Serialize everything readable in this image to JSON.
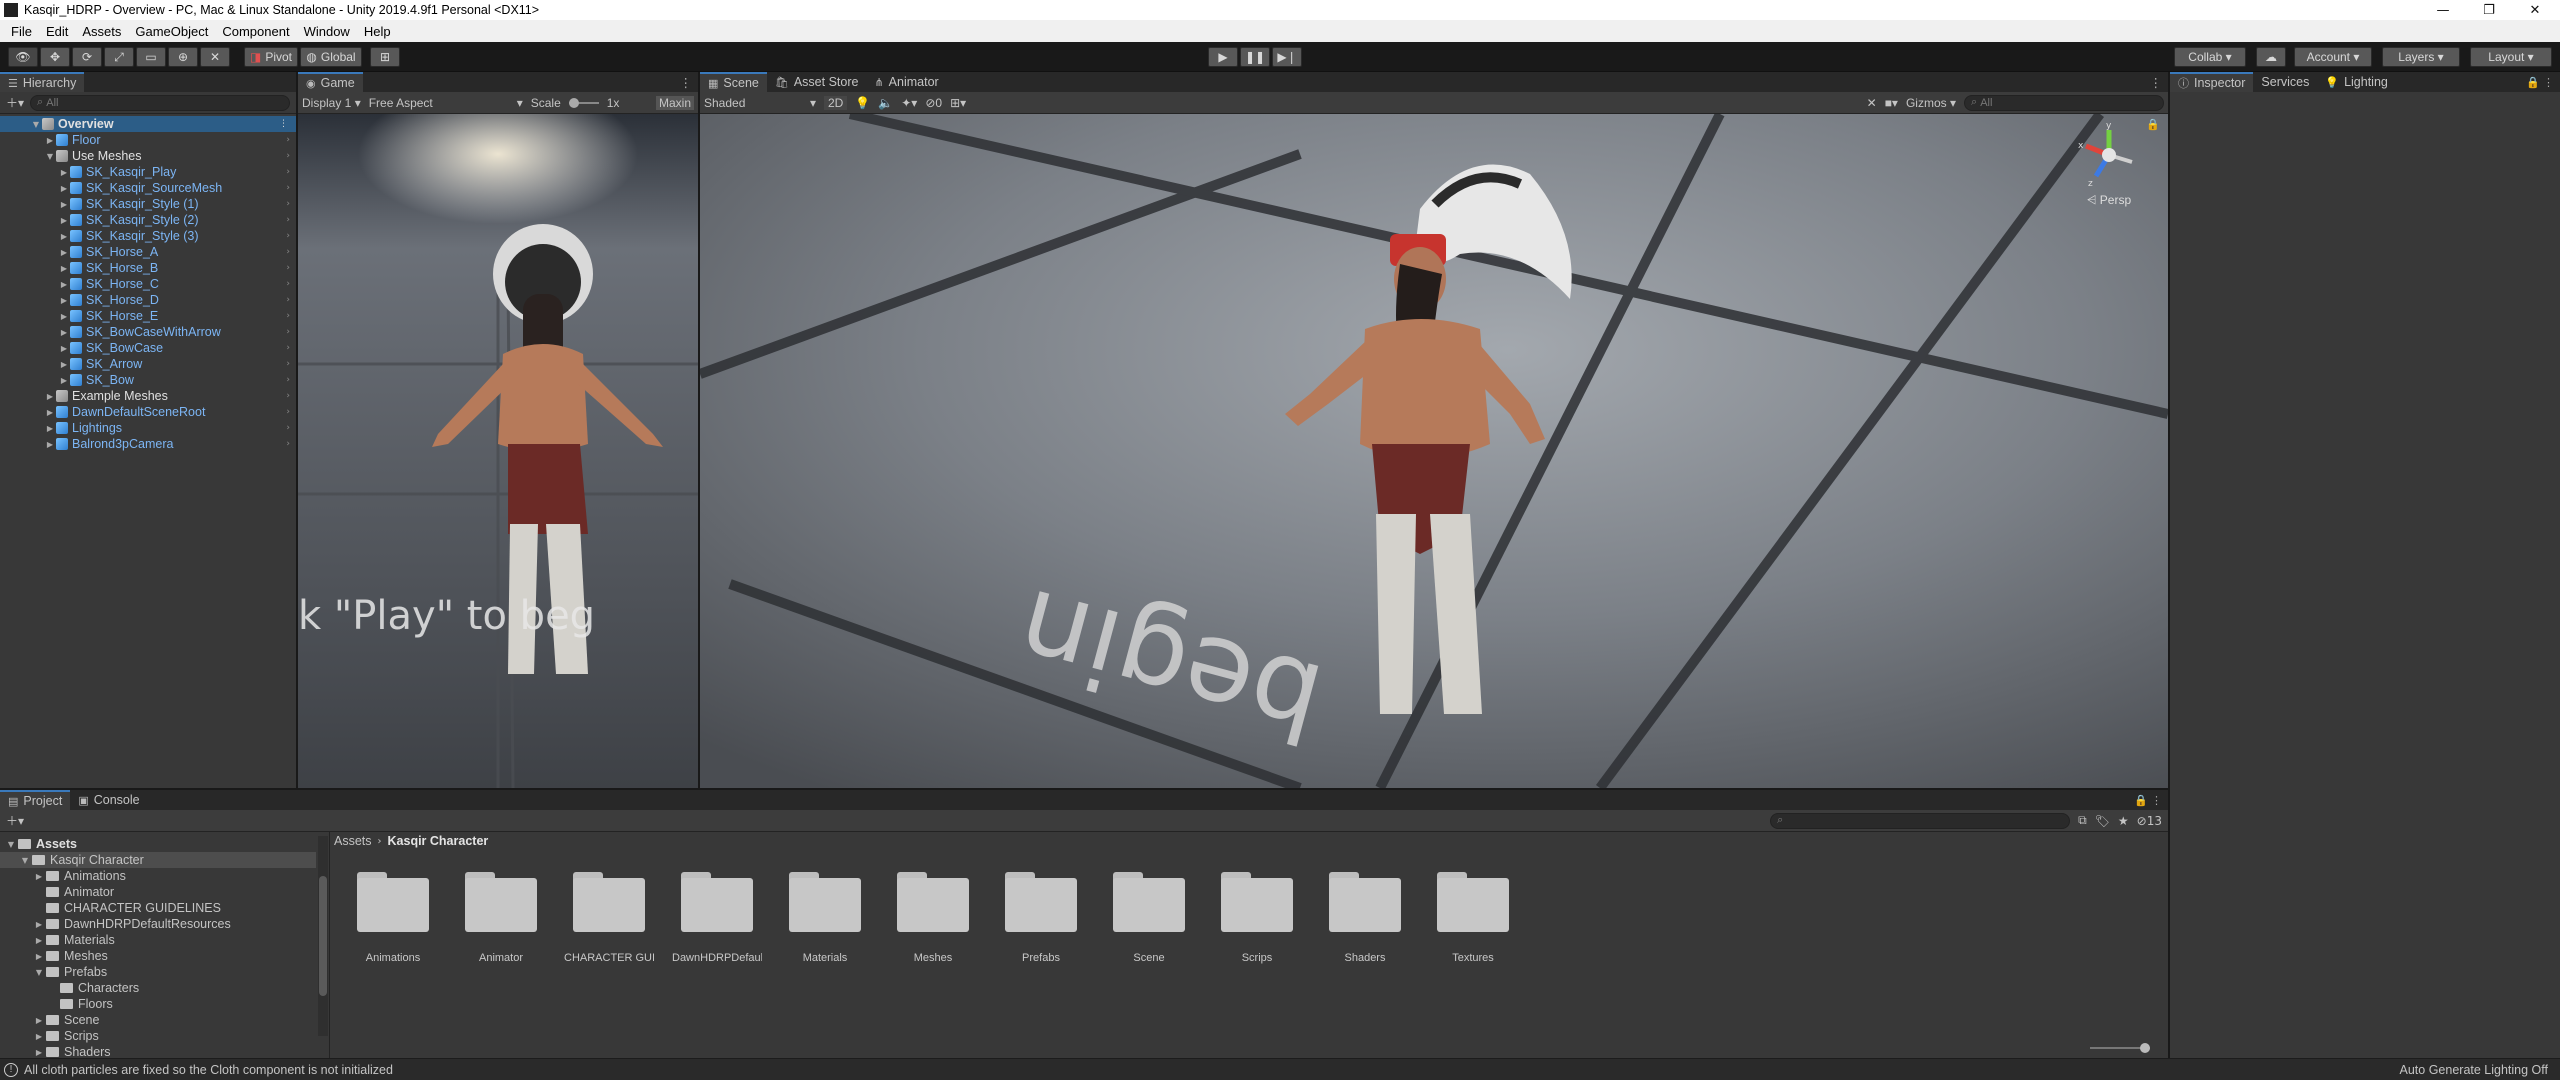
{
  "window": {
    "title": "Kasqir_HDRP - Overview - PC, Mac & Linux Standalone - Unity 2019.4.9f1 Personal <DX11>",
    "minimize": "—",
    "restore": "❐",
    "close": "✕"
  },
  "menu": [
    "File",
    "Edit",
    "Assets",
    "GameObject",
    "Component",
    "Window",
    "Help"
  ],
  "toolbar": {
    "pivot": "Pivot",
    "global": "Global",
    "collab": "Collab",
    "account": "Account",
    "layers": "Layers",
    "layout": "Layout"
  },
  "hierarchy": {
    "tab": "Hierarchy",
    "search_placeholder": "All",
    "scene": "Overview",
    "items": [
      {
        "label": "Floor",
        "indent": 1,
        "arrow": "▶",
        "icon": "cube",
        "color": "blue"
      },
      {
        "label": "Use Meshes",
        "indent": 1,
        "arrow": "▼",
        "icon": "grey",
        "color": "white"
      },
      {
        "label": "SK_Kasqir_Play",
        "indent": 2,
        "arrow": "▶",
        "icon": "cube",
        "color": "blue"
      },
      {
        "label": "SK_Kasqir_SourceMesh",
        "indent": 2,
        "arrow": "▶",
        "icon": "cube",
        "color": "blue"
      },
      {
        "label": "SK_Kasqir_Style (1)",
        "indent": 2,
        "arrow": "▶",
        "icon": "cube",
        "color": "blue"
      },
      {
        "label": "SK_Kasqir_Style (2)",
        "indent": 2,
        "arrow": "▶",
        "icon": "cube",
        "color": "blue"
      },
      {
        "label": "SK_Kasqir_Style (3)",
        "indent": 2,
        "arrow": "▶",
        "icon": "cube",
        "color": "blue"
      },
      {
        "label": "SK_Horse_A",
        "indent": 2,
        "arrow": "▶",
        "icon": "cube",
        "color": "blue"
      },
      {
        "label": "SK_Horse_B",
        "indent": 2,
        "arrow": "▶",
        "icon": "cube",
        "color": "blue"
      },
      {
        "label": "SK_Horse_C",
        "indent": 2,
        "arrow": "▶",
        "icon": "cube",
        "color": "blue"
      },
      {
        "label": "SK_Horse_D",
        "indent": 2,
        "arrow": "▶",
        "icon": "cube",
        "color": "blue"
      },
      {
        "label": "SK_Horse_E",
        "indent": 2,
        "arrow": "▶",
        "icon": "cube",
        "color": "blue"
      },
      {
        "label": "SK_BowCaseWithArrow",
        "indent": 2,
        "arrow": "▶",
        "icon": "cube",
        "color": "blue"
      },
      {
        "label": "SK_BowCase",
        "indent": 2,
        "arrow": "▶",
        "icon": "cube",
        "color": "blue"
      },
      {
        "label": "SK_Arrow",
        "indent": 2,
        "arrow": "▶",
        "icon": "cube",
        "color": "blue"
      },
      {
        "label": "SK_Bow",
        "indent": 2,
        "arrow": "▶",
        "icon": "cube",
        "color": "blue"
      },
      {
        "label": "Example Meshes",
        "indent": 1,
        "arrow": "▶",
        "icon": "grey",
        "color": "white"
      },
      {
        "label": "DawnDefaultSceneRoot",
        "indent": 1,
        "arrow": "▶",
        "icon": "cube",
        "color": "blue"
      },
      {
        "label": "Lightings",
        "indent": 1,
        "arrow": "▶",
        "icon": "cube",
        "color": "blue"
      },
      {
        "label": "Balrond3pCamera",
        "indent": 1,
        "arrow": "▶",
        "icon": "cube",
        "color": "blue"
      }
    ]
  },
  "game": {
    "tab": "Game",
    "display": "Display 1",
    "aspect": "Free Aspect",
    "scale_label": "Scale",
    "scale_value": "1x",
    "maximize": "Maxin",
    "overlay_text": "k \"Play\" to beg"
  },
  "scene": {
    "tab": "Scene",
    "asset_store": "Asset Store",
    "animator": "Animator",
    "shading": "Shaded",
    "mode_2d": "2D",
    "gizmos": "Gizmos",
    "search_placeholder": "All",
    "fx_count": "0",
    "persp": "Persp",
    "axis_x": "x",
    "axis_y": "y",
    "axis_z": "z",
    "floor_text": "begin"
  },
  "inspector": {
    "tabs": [
      "Inspector",
      "Services",
      "Lighting"
    ]
  },
  "project": {
    "tab": "Project",
    "console": "Console",
    "hidden_count": "13",
    "breadcrumb": [
      "Assets",
      "Kasqir Character"
    ],
    "tree": [
      {
        "label": "Assets",
        "level": 0,
        "arrow": "▼",
        "bold": true
      },
      {
        "label": "Kasqir Character",
        "level": 1,
        "arrow": "▼",
        "selected": true
      },
      {
        "label": "Animations",
        "level": 2,
        "arrow": "▶"
      },
      {
        "label": "Animator",
        "level": 2,
        "arrow": ""
      },
      {
        "label": "CHARACTER GUIDELINES",
        "level": 2,
        "arrow": ""
      },
      {
        "label": "DawnHDRPDefaultResources",
        "level": 2,
        "arrow": "▶"
      },
      {
        "label": "Materials",
        "level": 2,
        "arrow": "▶"
      },
      {
        "label": "Meshes",
        "level": 2,
        "arrow": "▶"
      },
      {
        "label": "Prefabs",
        "level": 2,
        "arrow": "▼"
      },
      {
        "label": "Characters",
        "level": 3,
        "arrow": ""
      },
      {
        "label": "Floors",
        "level": 3,
        "arrow": ""
      },
      {
        "label": "Scene",
        "level": 2,
        "arrow": "▶"
      },
      {
        "label": "Scrips",
        "level": 2,
        "arrow": "▶"
      },
      {
        "label": "Shaders",
        "level": 2,
        "arrow": "▶"
      }
    ],
    "folders": [
      "Animations",
      "Animator",
      "CHARACTER GUI...",
      "DawnHDRPDefaul...",
      "Materials",
      "Meshes",
      "Prefabs",
      "Scene",
      "Scrips",
      "Shaders",
      "Textures"
    ]
  },
  "status": {
    "message": "All cloth particles are fixed so the Cloth component is not initialized",
    "right": "Auto Generate Lighting Off"
  },
  "colors": {
    "accent": "#3a79bb",
    "hierarchy_blue": "#7cb5f4"
  }
}
